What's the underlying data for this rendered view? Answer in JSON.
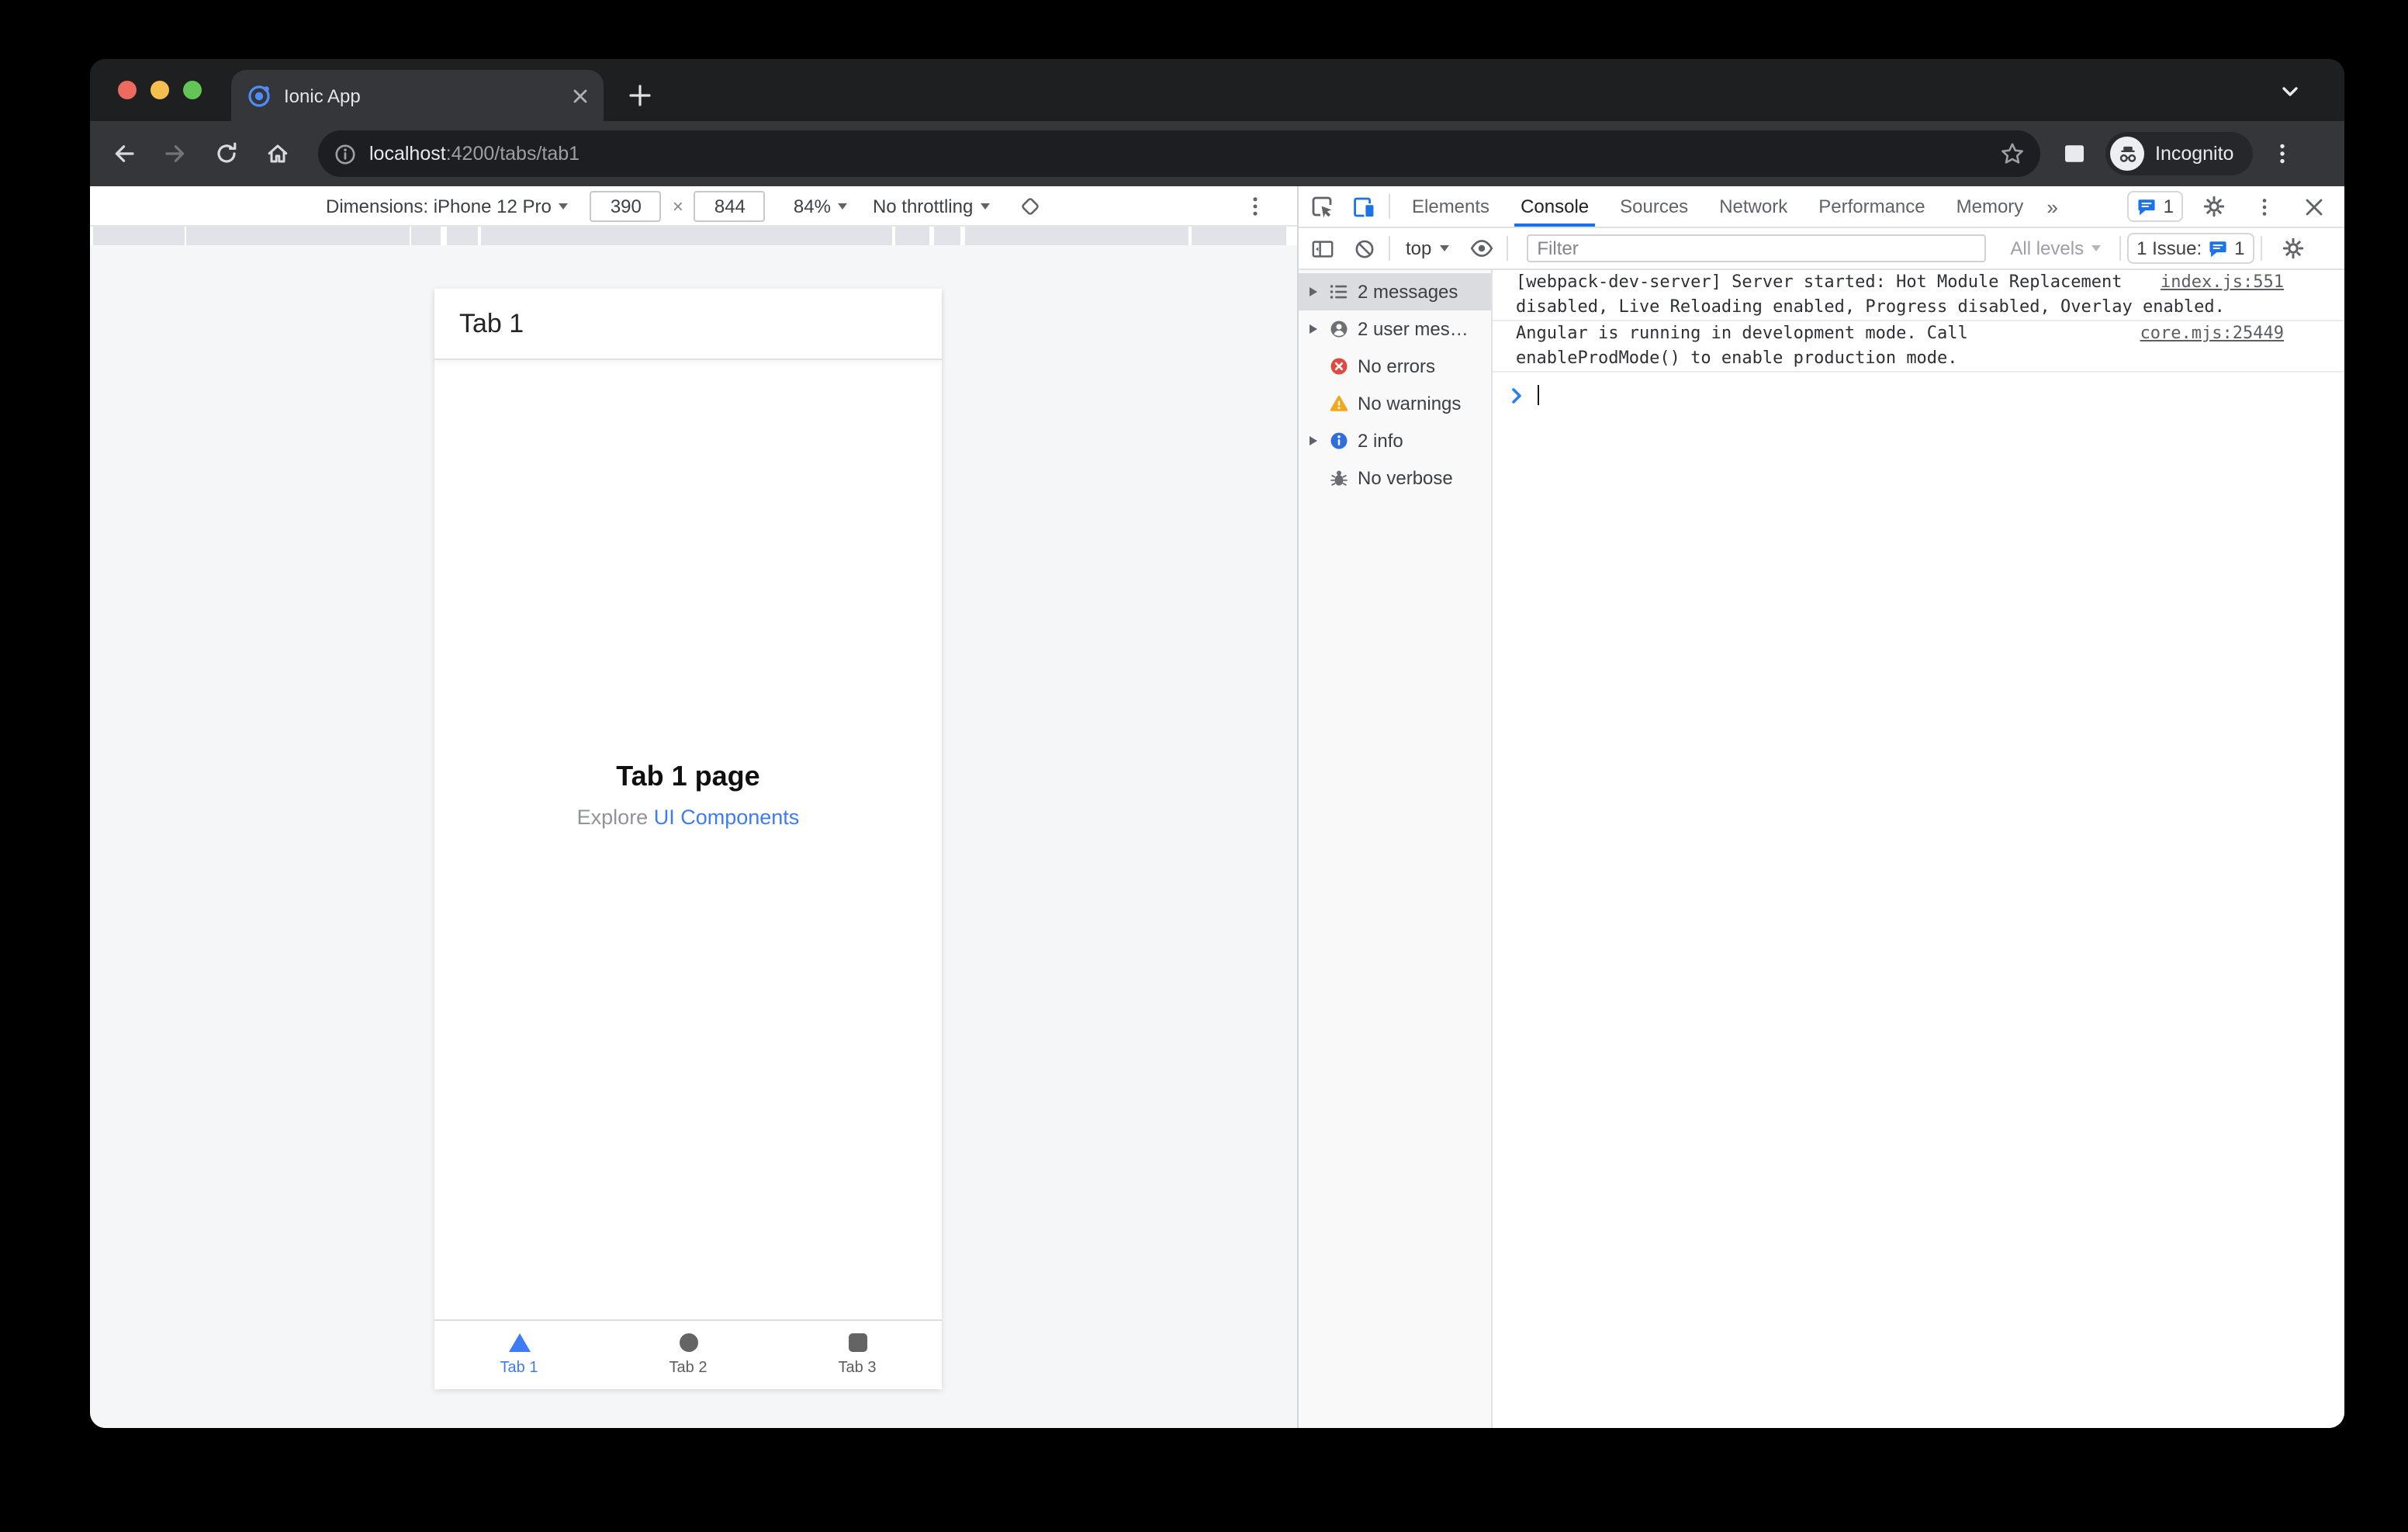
{
  "browser": {
    "tab_title": "Ionic App",
    "url_host": "localhost",
    "url_path": ":4200/tabs/tab1",
    "incognito_label": "Incognito"
  },
  "device_toolbar": {
    "dimensions_label": "Dimensions: iPhone 12 Pro",
    "width": "390",
    "separator": "×",
    "height": "844",
    "zoom": "84%",
    "throttling": "No throttling"
  },
  "app": {
    "header_title": "Tab 1",
    "page_title": "Tab 1 page",
    "subtitle_text": "Explore ",
    "subtitle_link": "UI Components",
    "tabs": [
      {
        "label": "Tab 1"
      },
      {
        "label": "Tab 2"
      },
      {
        "label": "Tab 3"
      }
    ]
  },
  "devtools": {
    "tabs": [
      {
        "label": "Elements"
      },
      {
        "label": "Console"
      },
      {
        "label": "Sources"
      },
      {
        "label": "Network"
      },
      {
        "label": "Performance"
      },
      {
        "label": "Memory"
      }
    ],
    "more_tabs": "»",
    "issue_count": "1",
    "console": {
      "context": "top",
      "filter_placeholder": "Filter",
      "levels": "All levels",
      "issue_label": "1 Issue:",
      "issue_count": "1",
      "sidebar": [
        {
          "label": "2 messages"
        },
        {
          "label": "2 user mes…"
        },
        {
          "label": "No errors"
        },
        {
          "label": "No warnings"
        },
        {
          "label": "2 info"
        },
        {
          "label": "No verbose"
        }
      ],
      "messages": [
        {
          "text": "[webpack-dev-server] Server started: Hot Module Replacement disabled, Live Reloading enabled, Progress disabled, Overlay enabled.",
          "source": "index.js:551"
        },
        {
          "text": "Angular is running in development mode. Call enableProdMode() to enable production mode.",
          "source": "core.mjs:25449"
        }
      ]
    }
  },
  "colors": {
    "devtools_accent": "#1a73e8",
    "app_primary": "#3d7cf5",
    "error_red": "#df4940",
    "warning_yellow": "#f3a81c",
    "info_blue": "#2f6fdb"
  }
}
